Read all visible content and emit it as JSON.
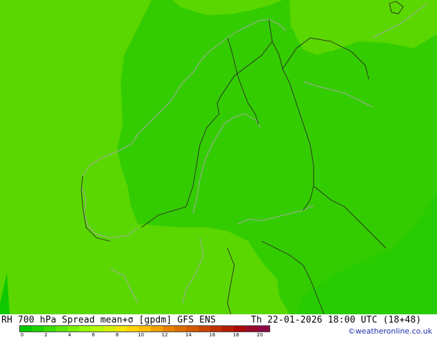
{
  "footer": {
    "left": "RH 700 hPa Spread mean+σ [gpdm] GFS ENS",
    "right": "Th 22-01-2026 18:00 UTC (18+48)",
    "credit": "©weatheronline.co.uk"
  },
  "legend": {
    "colors": [
      "#00c800",
      "#1ed200",
      "#3cdc00",
      "#5ae600",
      "#78f000",
      "#96fa00",
      "#b4fa00",
      "#d2f000",
      "#f0e600",
      "#ffd200",
      "#ffbe00",
      "#f0a000",
      "#e68200",
      "#dc6e00",
      "#d25a00",
      "#c84600",
      "#be3200",
      "#b41e00",
      "#aa0a0a",
      "#9a0a28",
      "#8c0a46"
    ],
    "ticks": [
      "0",
      "2",
      "4",
      "6",
      "8",
      "10",
      "12",
      "14",
      "16",
      "18",
      "20"
    ]
  },
  "map": {
    "region": "Scandinavia / Finland",
    "light_green": "#5ad700",
    "mid_green": "#33cc00",
    "dark_green": "#10c800",
    "coast_color": "#a8a8a8",
    "border_color": "#2a2a2a"
  }
}
